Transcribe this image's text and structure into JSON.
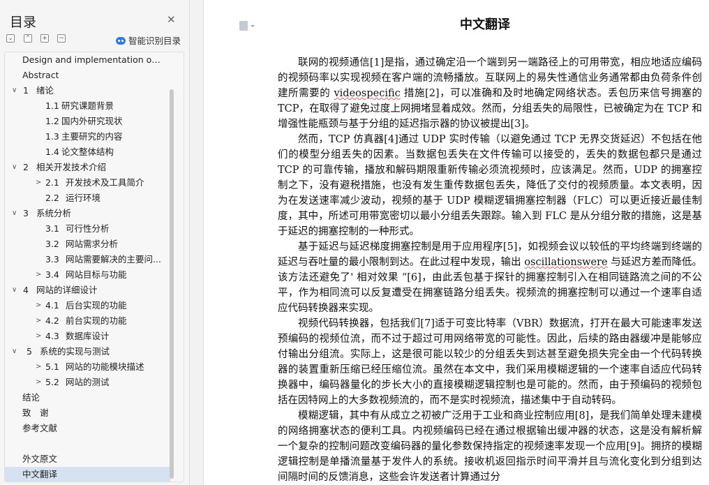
{
  "toc": {
    "title": "目录",
    "smart_label": "智能识别目录",
    "items": [
      {
        "num": "",
        "text": "Design and implementation of Ja..."
      },
      {
        "num": "",
        "text": "Abstract"
      },
      {
        "num": "1",
        "text": "绪论"
      },
      {
        "num": "1.1",
        "text": "研究课题背景"
      },
      {
        "num": "1.2",
        "text": "国内外研究现状"
      },
      {
        "num": "1.3",
        "text": "主要研究的内容"
      },
      {
        "num": "1.4",
        "text": "论文整体结构"
      },
      {
        "num": "2",
        "text": "相关开发技术介绍"
      },
      {
        "num": "2.1",
        "text": "开发技术及工具简介"
      },
      {
        "num": "2.2",
        "text": "运行环境"
      },
      {
        "num": "3",
        "text": "系统分析"
      },
      {
        "num": "3.1",
        "text": "可行性分析"
      },
      {
        "num": "3.2",
        "text": "网站需求分析"
      },
      {
        "num": "3.3",
        "text": "网站需要解决的主要问..."
      },
      {
        "num": "3.4",
        "text": "网站目标与功能"
      },
      {
        "num": "4",
        "text": "网站的详细设计"
      },
      {
        "num": "4.1",
        "text": "后台实现的功能"
      },
      {
        "num": "4.2",
        "text": "前台实现的功能"
      },
      {
        "num": "4.3",
        "text": "数据库设计"
      },
      {
        "num": "5",
        "text": "系统的实现与测试"
      },
      {
        "num": "5.1",
        "text": "网站的功能模块描述"
      },
      {
        "num": "5.2",
        "text": "网站的测试"
      },
      {
        "num": "",
        "text": "结论"
      },
      {
        "num": "",
        "text": "致　谢"
      },
      {
        "num": "",
        "text": "参考文献"
      },
      {
        "num": "",
        "text": ""
      },
      {
        "num": "",
        "text": "外文原文"
      },
      {
        "num": "",
        "text": "中文翻译"
      }
    ]
  },
  "document": {
    "title": "中文翻译",
    "p1": {
      "a": "联网的视频通信[1]是指，通过确定沿一个端到另一端路径上的可用带宽，相应地适应编码的视频码率以实现视频在客户端的流畅播放。互联网上的易失性通信业务通常都由负荷条件创建所需要的 ",
      "b": "videospecific",
      "c": " 措施[2]，可以准确和及时地确定网络状态。丢包历来信号拥塞的 TCP，在取得了避免过度上网拥堵显着成效。然而，分组丢失的局限性，已被确定为在 TCP 和增强性能瓶颈与基于分组的延迟指示器的协议被提出[3]。"
    },
    "p2": "然而，TCP 仿真器[4]通过 UDP 实时传输（以避免通过 TCP 无界交货延迟）不包括在他们的模型分组丢失的因素。当数据包丢失在文件传输可以接受的，丢失的数据包都只是通过 TCP 的可靠传输，播放和解码期限重新传输必须流视频时，应该满足。然而，UDP 的拥塞控制之下，没有避税措施，也没有发生重传数据包丢失，降低了交付的视频质量。本文表明，因为在发送速率减少波动，视频的基于 UDP 模糊逻辑拥塞控制器（FLC）可以更近接近最佳制度，其中，所述可用带宽密切以最小分组丢失跟踪。输入到 FLC 是从分组分散的措施，这是基于延迟的拥塞控制的一种形式。",
    "p3": {
      "a": "基于延迟与延迟梯度拥塞控制是用于应用程序[5]，如视频会议以较低的平均终端到终端的延迟与吞吐量的最小限制到达。在此过程中发现，输出 ",
      "b": "oscillationswere",
      "c": " 与延迟方差而降低。该方法还避免了' 相对效果 “[6]，由此丢包基于探针的拥塞控制引入在相同链路流之间的不公平，作为相同流可以反复遭受在拥塞链路分组丢失。视频流的拥塞控制可以通过一个速率自适应代码转换器来实现。"
    },
    "p4": "视频代码转换器，包括我们[7]适于可变比特率（VBR）数据流，打开在最大可能速率发送预编码的视频位流，而不过于超过可用网络带宽的可能性。因此，后续的路由器缓冲是能够应付输出分组流。实际上，这是很可能以较少的分组丢失到达甚至避免损失完全由一个代码转换器的装置重新压缩已经压缩位流。虽然在本文中，我们采用模糊逻辑的一个速率自适应代码转换器中，编码器量化的步长大小的直接模糊逻辑控制也是可能的。然而，由于预编码的视频包括在因特网上的大多数视频流的，而不是实时视频流，描述集中于自动转码。",
    "p5": "模糊逻辑，其中有从成立之初被广泛用于工业和商业控制应用[8]，是我们简单处理未建模的网络拥塞状态的便利工具。内视频编码已经在通过根据输出缓冲器的状态，这是没有解析解一个复杂的控制问题改变编码器的量化参数保持指定的视频速率发现一个应用[9]。拥挤的模糊逻辑控制是单播流量基于发件人的系统。接收机返回指示时间平滑并且与流化变化到分组到达间隔时间的反馈消息，这些会许发送者计算通过分"
  }
}
